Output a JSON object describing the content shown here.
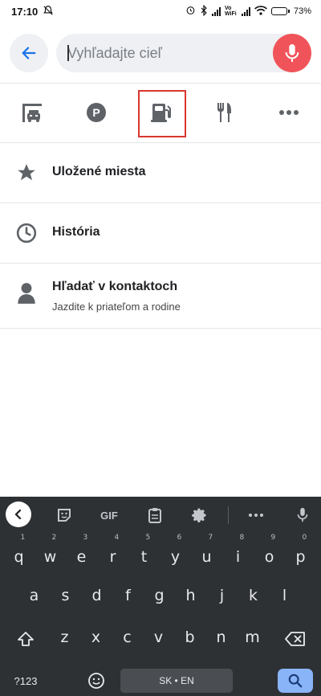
{
  "status_bar": {
    "time": "17:10",
    "network_label": "Vo WiFi",
    "battery": "73%",
    "battery_level": 0.73
  },
  "search": {
    "back_icon": "arrow-left-icon",
    "placeholder": "Vyhľadajte cieľ",
    "value": "",
    "mic_icon": "microphone-icon",
    "accent_color": "#f0545a"
  },
  "categories": [
    {
      "name": "drive-through",
      "icon": "drive-through-icon",
      "selected": false
    },
    {
      "name": "parking",
      "icon": "parking-icon",
      "selected": false
    },
    {
      "name": "gas-station",
      "icon": "gas-station-icon",
      "selected": true
    },
    {
      "name": "restaurants",
      "icon": "restaurant-icon",
      "selected": false
    },
    {
      "name": "more",
      "icon": "more-horizontal-icon",
      "selected": false
    }
  ],
  "list": [
    {
      "icon": "star-icon",
      "title": "Uložené miesta",
      "subtitle": ""
    },
    {
      "icon": "history-icon",
      "title": "História",
      "subtitle": ""
    },
    {
      "icon": "contact-icon",
      "title": "Hľadať v kontaktoch",
      "subtitle": "Jazdite k priateľom a rodine"
    }
  ],
  "keyboard": {
    "toolbar": {
      "gif_label": "GIF"
    },
    "row1": [
      "q",
      "w",
      "e",
      "r",
      "t",
      "y",
      "u",
      "i",
      "o",
      "p"
    ],
    "row1_hints": [
      "1",
      "2",
      "3",
      "4",
      "5",
      "6",
      "7",
      "8",
      "9",
      "0"
    ],
    "row2": [
      "a",
      "s",
      "d",
      "f",
      "g",
      "h",
      "j",
      "k",
      "l"
    ],
    "row3": [
      "z",
      "x",
      "c",
      "v",
      "b",
      "n",
      "m"
    ],
    "mode_key": "?123",
    "space_label": "SK • EN"
  }
}
